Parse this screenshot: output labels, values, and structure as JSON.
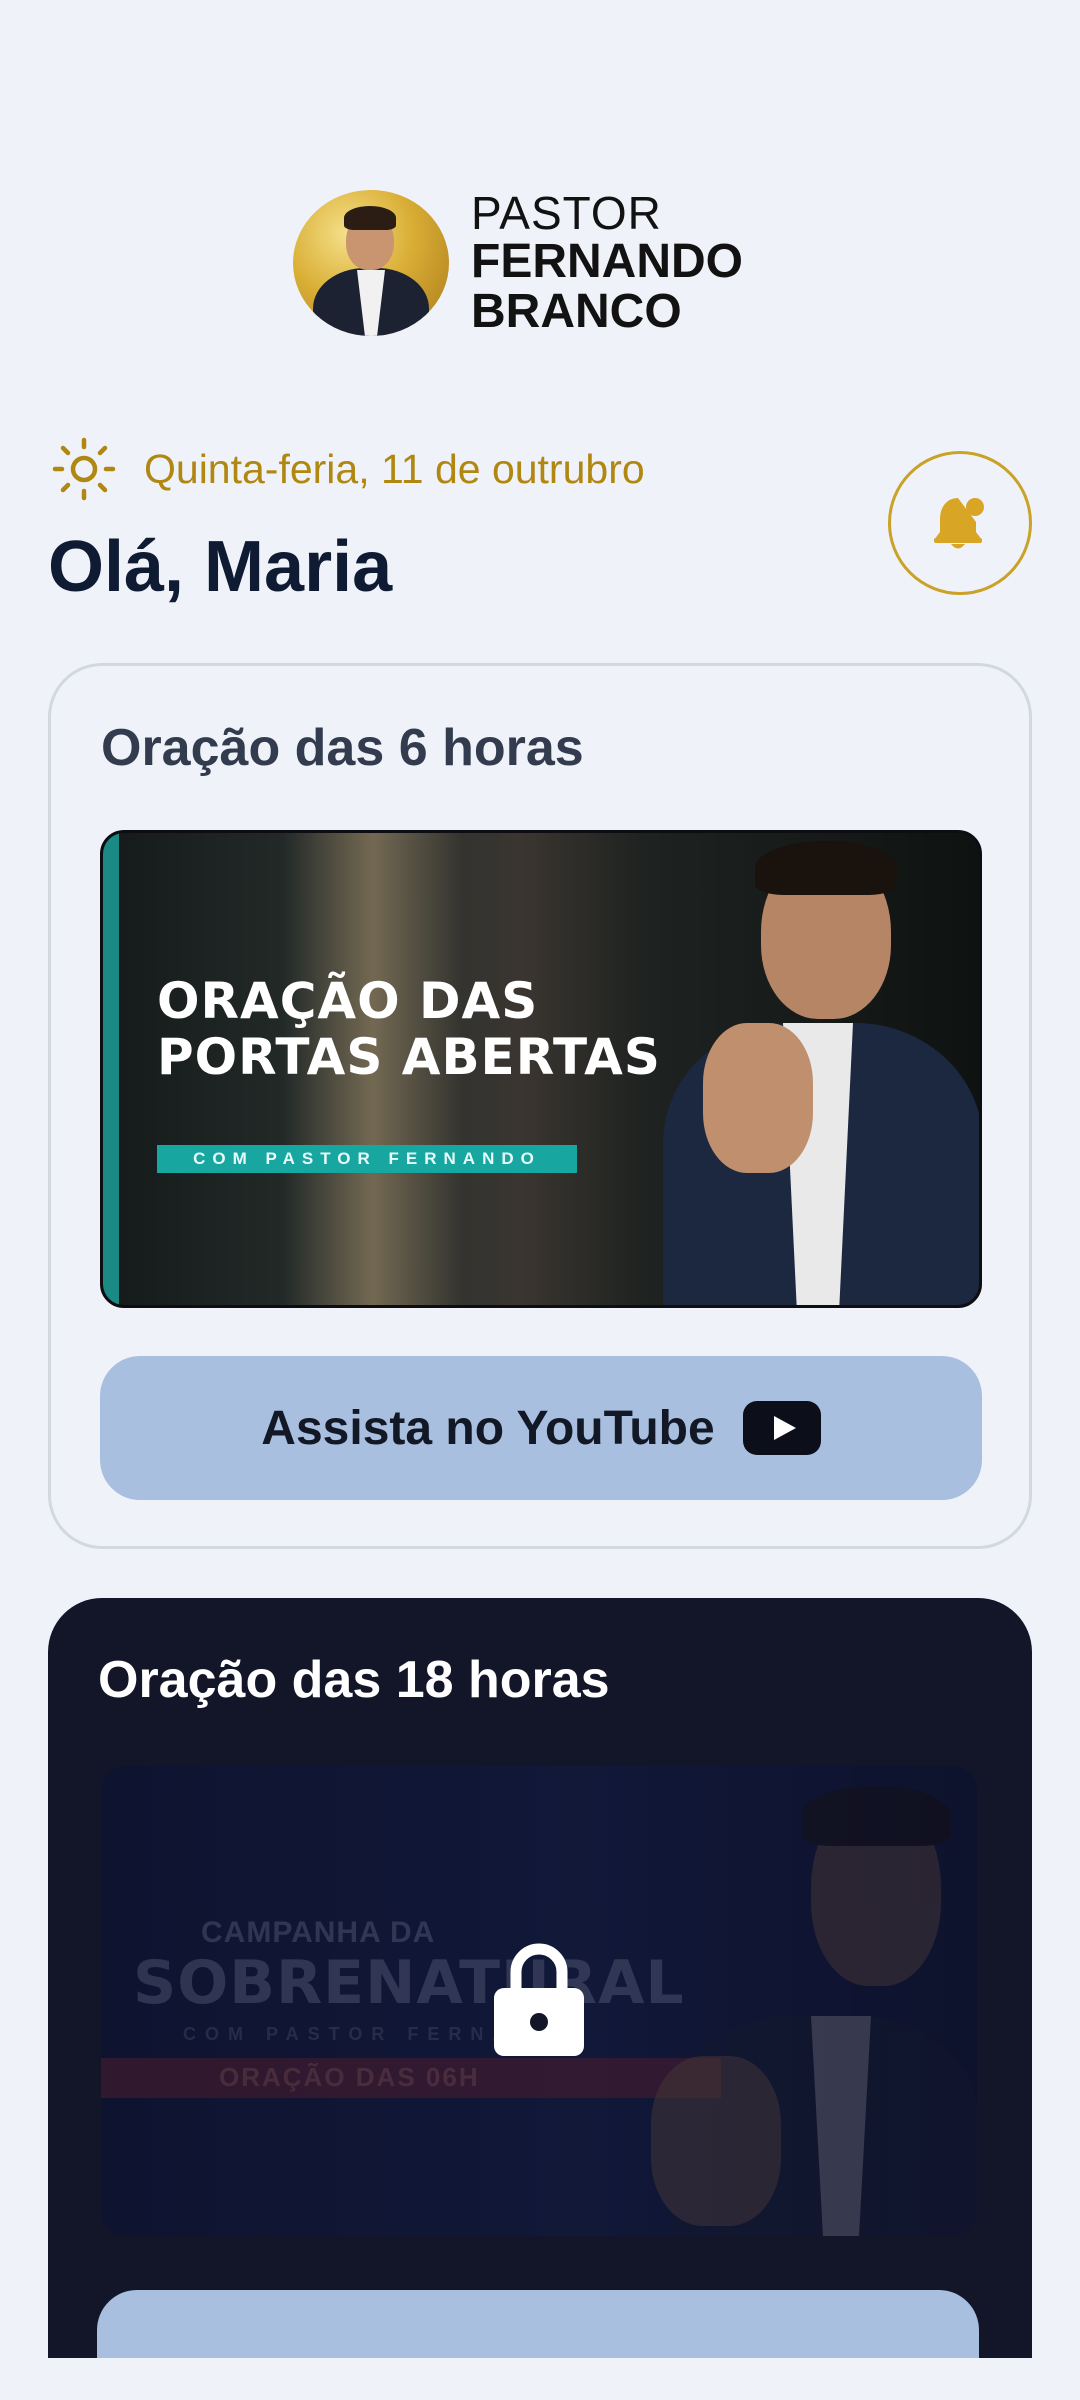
{
  "logo": {
    "line1": "PASTOR",
    "line2": "FERNANDO",
    "line3": "BRANCO"
  },
  "header": {
    "date": "Quinta-feria, 11 de outrubro",
    "greeting": "Olá, Maria",
    "date_icon": "sun-icon",
    "notification_icon": "bell-icon"
  },
  "cards": [
    {
      "title": "Oração das 6 horas",
      "thumbnail": {
        "title": "ORAÇÃO DAS PORTAS ABERTAS",
        "subtitle": "COM PASTOR FERNANDO"
      },
      "button_label": "Assista no YouTube",
      "button_icon": "youtube-icon",
      "locked": false
    },
    {
      "title": "Oração das 18 horas",
      "thumbnail": {
        "line1": "CAMPANHA DA",
        "line2": "SOBRENATURAL",
        "line3": "COM PASTOR FERNANDO",
        "line4": "ORAÇÃO DAS 06H"
      },
      "locked": true,
      "lock_icon": "lock-icon"
    }
  ],
  "colors": {
    "background": "#eff3f9",
    "accent_gold": "#b08710",
    "heading_dark": "#0f1b33",
    "button_blue": "#a9bfdf",
    "dark_card": "#131628"
  }
}
